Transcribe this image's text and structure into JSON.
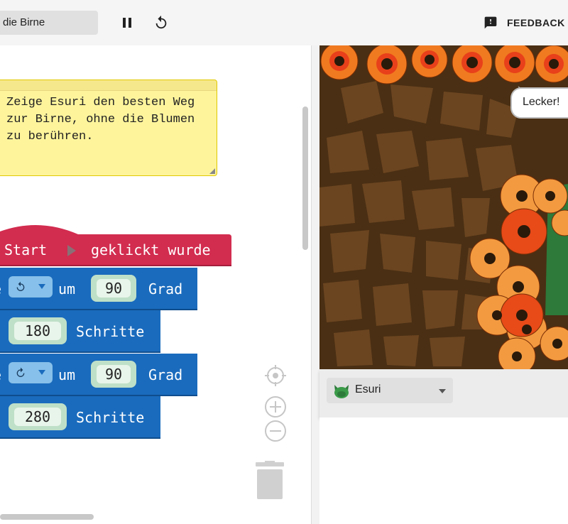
{
  "toolbar": {
    "title": "die Birne",
    "feedback_label": "FEEDBACK"
  },
  "comment": {
    "line1": "Zeige Esuri den besten Weg",
    "line2": "zur Birne, ohne die Blumen",
    "line3": "zu berühren."
  },
  "blocks": {
    "hat_start": "Start",
    "hat_clicked": "geklickt wurde",
    "turn1_prefix": "e",
    "turn1_um": "um",
    "turn1_value": "90",
    "turn1_unit": "Grad",
    "move1_value": "180",
    "move1_unit": "Schritte",
    "turn2_prefix": "e",
    "turn2_um": "um",
    "turn2_value": "90",
    "turn2_unit": "Grad",
    "move2_value": "280",
    "move2_unit": "Schritte"
  },
  "stage": {
    "speech": "Lecker!"
  },
  "sprite_selector": {
    "selected": "Esuri"
  },
  "colors": {
    "event_block": "#d22c4f",
    "motion_block": "#1a6bbd",
    "comment_bg": "#fef49c"
  }
}
